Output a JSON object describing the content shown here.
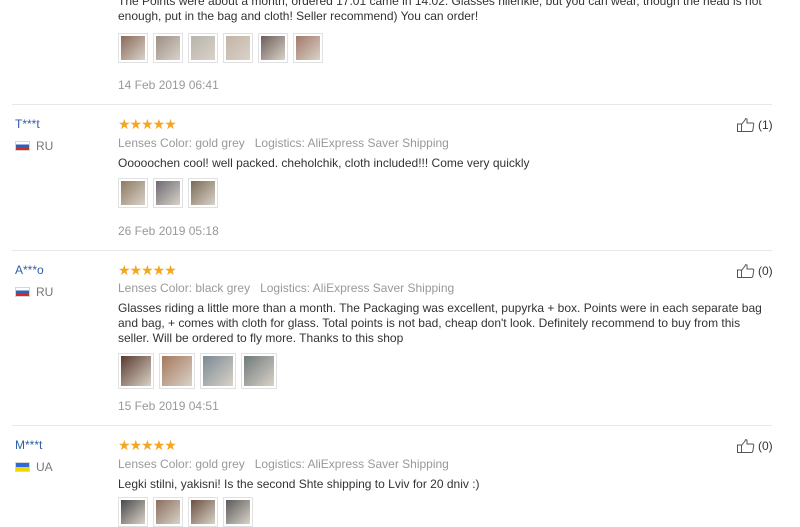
{
  "reviews": [
    {
      "text": "The Points were about a month, ordered 17.01 came in 14.02. Glasses hilenkie, but you can wear, though the head is not enough, put in the bag and cloth! Seller recommend) You can order!",
      "date": "14 Feb 2019 06:41",
      "photo_colors": [
        "#8a6a5a",
        "#9c8f86",
        "#b8b4ab",
        "#c4b3a6",
        "#6b5e5a",
        "#a27a6b"
      ]
    },
    {
      "user": "T***t",
      "country": "RU",
      "stars": "★★★★★",
      "color_label": "Lenses Color: gold grey",
      "logistics": "Logistics: AliExpress Saver Shipping",
      "text": "Ooooochen cool! well packed. cheholchik, cloth included!!! Come very quickly",
      "date": "26 Feb 2019 05:18",
      "helpful": "(1)",
      "photo_colors": [
        "#8d7a63",
        "#6d6a73",
        "#7b6b57"
      ]
    },
    {
      "user": "A***o",
      "country": "RU",
      "stars": "★★★★★",
      "color_label": "Lenses Color: black grey",
      "logistics": "Logistics: AliExpress Saver Shipping",
      "text": "Glasses riding a little more than a month. The Packaging was excellent, pupyrka + box. Points were in each separate bag and bag, + comes with cloth for glass. Total points is not bad, cheap don't look. Definitely recommend to buy from this seller. Will be ordered to fly more. Thanks to this shop",
      "date": "15 Feb 2019 04:51",
      "helpful": "(0)",
      "photo_colors": [
        "#5a3a2e",
        "#a5785e",
        "#7b8a94",
        "#707a7b"
      ]
    },
    {
      "user": "M***t",
      "country": "UA",
      "stars": "★★★★★",
      "color_label": "Lenses Color: gold grey",
      "logistics": "Logistics: AliExpress Saver Shipping",
      "text": "Legki stilni, yakisni! Is the second Shte shipping to Lviv for 20 dniv :)",
      "helpful": "(0)",
      "photo_colors": [
        "#4a4a4a",
        "#8a6e5d",
        "#6a5040",
        "#5b5b5b"
      ]
    }
  ]
}
